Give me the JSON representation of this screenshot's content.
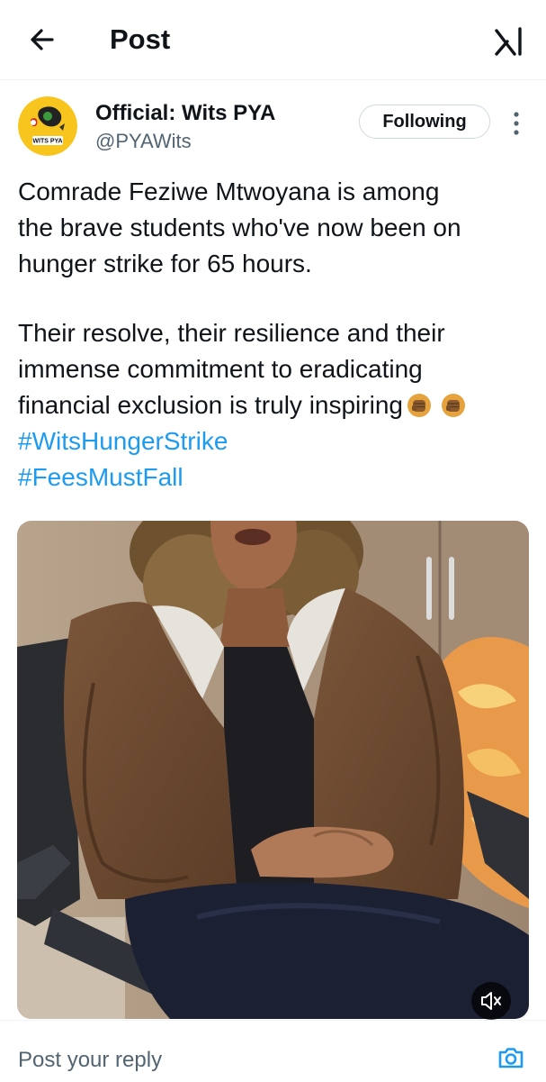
{
  "header": {
    "title": "Post",
    "back_icon": "arrow-left-icon",
    "grok_icon": "grok-icon"
  },
  "author": {
    "display_name": "Official: Wits PYA",
    "handle": "@PYAWits",
    "avatar_text": "WITS PYA",
    "follow_label": "Following",
    "more_icon": "more-vertical-icon"
  },
  "post": {
    "lines": [
      "Comrade Feziwe Mtwoyana is among",
      "the brave students who've now been on",
      "hunger strike for 65 hours.",
      "Their resolve, their resilience and their",
      "immense commitment to eradicating",
      "financial exclusion is truly inspiring"
    ],
    "emoji_icon": "raised-fist-icon",
    "hashtags": [
      "#WitsHungerStrike",
      "#FeesMustFall"
    ]
  },
  "media": {
    "type": "video",
    "mute_icon": "volume-muted-icon"
  },
  "reply": {
    "placeholder": "Post your reply",
    "camera_icon": "camera-icon"
  },
  "colors": {
    "accent": "#1d9bf0",
    "secondary_text": "#536471",
    "border": "#cfd9de",
    "jacket": "#6e4a32",
    "leggings": "#1c2033",
    "cabinet": "#a58f7a"
  }
}
